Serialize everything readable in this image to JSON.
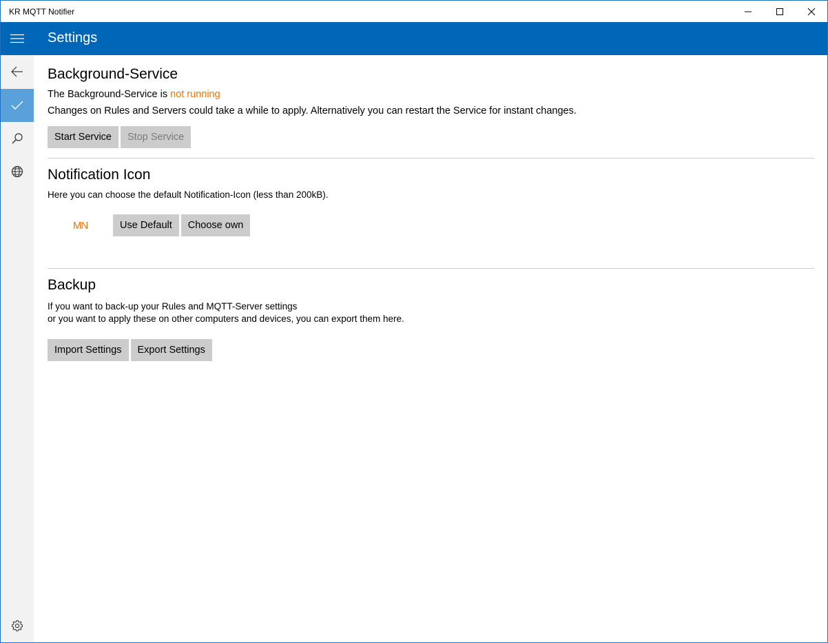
{
  "window": {
    "title": "KR MQTT Notifier"
  },
  "header": {
    "title": "Settings"
  },
  "nav": {
    "items": [
      {
        "icon": "back-arrow-icon"
      },
      {
        "icon": "check-icon",
        "selected": true
      },
      {
        "icon": "search-icon"
      },
      {
        "icon": "globe-icon"
      }
    ],
    "footer_icon": "gear-icon"
  },
  "accent_color": "#0067b8",
  "status_color": "#f07800",
  "background_service": {
    "title": "Background-Service",
    "status_prefix": "The Background-Service is ",
    "status_value": "not running",
    "description": "Changes on Rules and Servers could take a while to apply. Alternatively you can restart the Service for instant changes.",
    "start_label": "Start Service",
    "stop_label": "Stop Service"
  },
  "notification_icon": {
    "title": "Notification Icon",
    "description": "Here you can choose the default Notification-Icon (less than 200kB).",
    "preview_text": "MN",
    "use_default_label": "Use Default",
    "choose_own_label": "Choose own"
  },
  "backup": {
    "title": "Backup",
    "line1": "If you want to back-up your Rules and MQTT-Server settings",
    "line2": "or you want to apply these on other computers and devices, you can export them here.",
    "import_label": "Import Settings",
    "export_label": "Export Settings"
  }
}
